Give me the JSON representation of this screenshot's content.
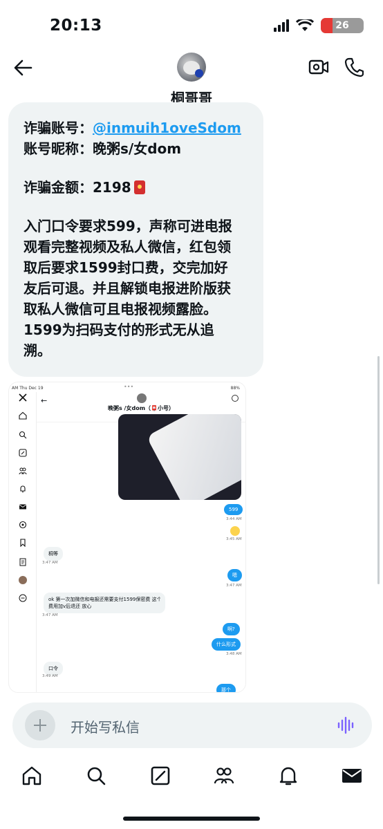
{
  "status_bar": {
    "time": "20:13",
    "battery": "26"
  },
  "header": {
    "contact_name": "桐哥哥"
  },
  "message": {
    "account_label": "诈骗账号：",
    "account_handle": "@inmuih1oveSdom",
    "nickname": "账号昵称：晚粥s/女dom",
    "amount_label": "诈骗金额：",
    "amount_value": "2198",
    "body_lines": [
      "入门口令要求599，声称可进电报",
      "观看完整视频及私人微信，红包领",
      "取后要求1599封口费，交完加好",
      "友后可退。并且解锁电报进阶版获",
      "取私人微信可且电报视频露脸。",
      "1599为扫码支付的形式无从追",
      "溯。"
    ]
  },
  "embedded_screenshot": {
    "status_left": "AM  Thu Dec 19",
    "status_mid": "•••",
    "status_right": "88%",
    "title": "晚粥s /女dom（📮小号）",
    "messages": [
      {
        "dir": "out",
        "text": "599",
        "time": "3:44 AM"
      },
      {
        "dir": "out_emoji",
        "text": "",
        "time": "3:45 AM"
      },
      {
        "dir": "in",
        "text": "桐等",
        "time": "3:47 AM"
      },
      {
        "dir": "out",
        "text": "嗯",
        "time": "3:47 AM"
      },
      {
        "dir": "in",
        "text": "ok 第一次加微信和电报还需要支付1599保密费 这个",
        "text2": "费用加v后退还 放心",
        "time": "3:47 AM"
      },
      {
        "dir": "out",
        "text": "啊?",
        "time": ""
      },
      {
        "dir": "out",
        "text": "什么形式",
        "time": "3:48 AM"
      },
      {
        "dir": "in",
        "text": "口令",
        "time": "3:49 AM"
      },
      {
        "dir": "out",
        "text": "那个",
        "time": ""
      }
    ]
  },
  "composer": {
    "placeholder": "开始写私信"
  },
  "nav": {
    "items": [
      "home-icon",
      "search-icon",
      "grok-icon",
      "communities-icon",
      "notifications-icon",
      "messages-icon"
    ]
  }
}
